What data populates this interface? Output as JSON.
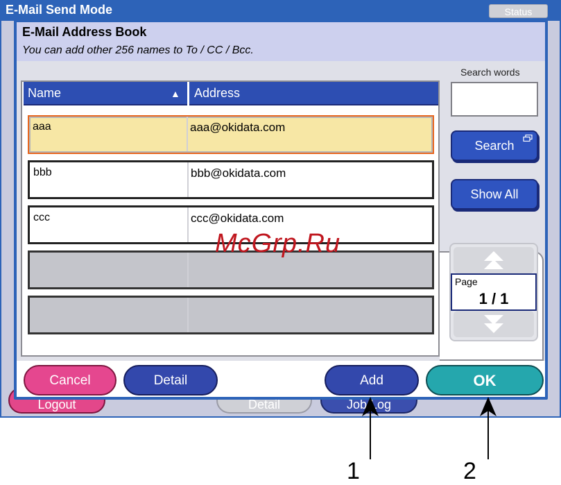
{
  "window": {
    "title": "E-Mail Send Mode",
    "status_label": "Status"
  },
  "background_buttons": {
    "logout": "Logout",
    "detail": "Detail",
    "job_log": "Job Log"
  },
  "dialog": {
    "title": "E-Mail Address Book",
    "subtitle": "You can add other 256 names to To / CC / Bcc."
  },
  "table": {
    "columns": [
      "Name",
      "Address"
    ],
    "sort_icon": "triangle-up-icon",
    "rows": [
      {
        "name": "aaa",
        "address": "aaa@okidata.com",
        "selected": true
      },
      {
        "name": "bbb",
        "address": "bbb@okidata.com",
        "selected": false
      },
      {
        "name": "ccc",
        "address": "ccc@okidata.com",
        "selected": false
      },
      {
        "name": "",
        "address": "",
        "selected": false
      },
      {
        "name": "",
        "address": "",
        "selected": false
      }
    ]
  },
  "search": {
    "label": "Search words",
    "value": "",
    "search_button": "Search",
    "show_all_button": "Show All"
  },
  "pager": {
    "label": "Page",
    "value": "1 / 1"
  },
  "footer": {
    "cancel": "Cancel",
    "detail": "Detail",
    "add": "Add",
    "ok": "OK"
  },
  "watermark": "McGrp.Ru",
  "callouts": [
    "1",
    "2"
  ],
  "colors": {
    "title_bar": "#2d63b8",
    "selected_row": "#f7e7a5",
    "cancel": "#e5478f",
    "ok": "#25a7ad",
    "primary_button": "#3348ac"
  }
}
